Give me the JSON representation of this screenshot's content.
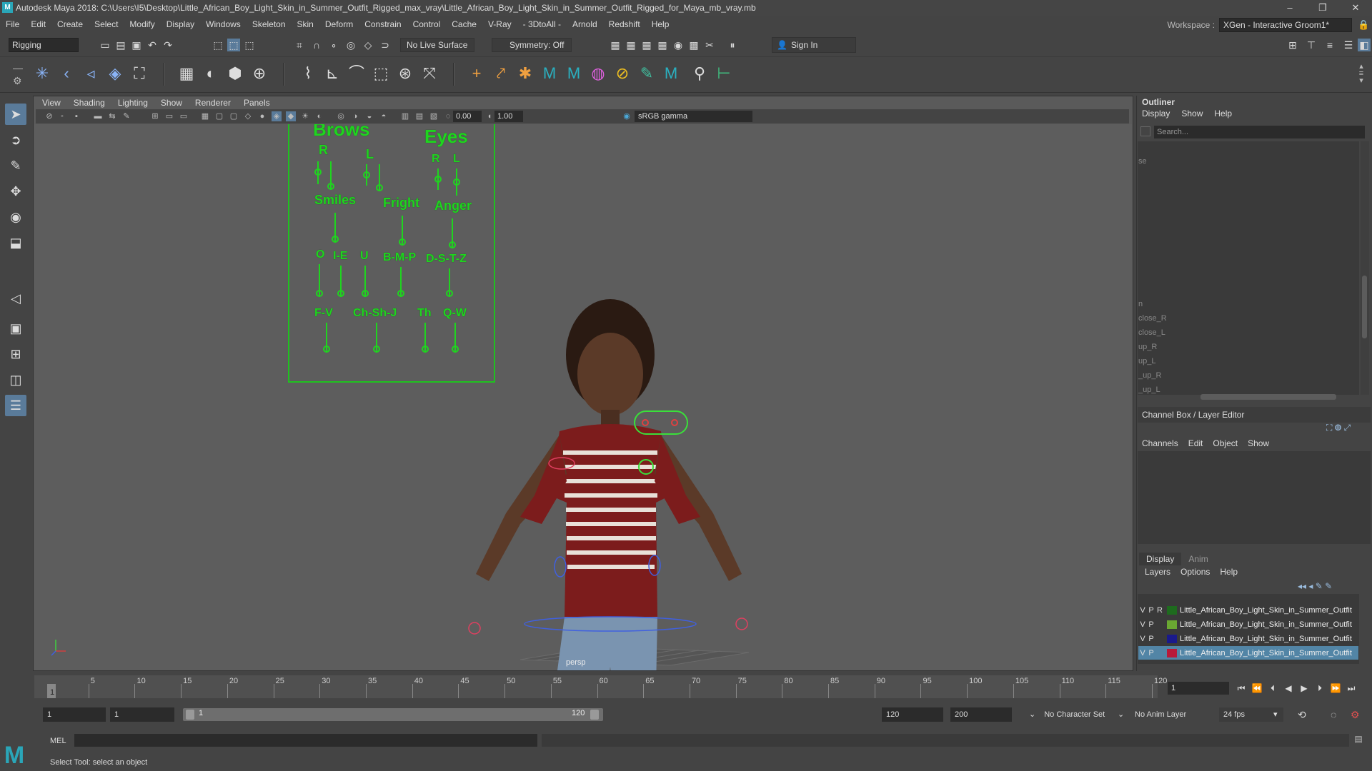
{
  "window": {
    "title": "Autodesk Maya 2018: C:\\Users\\I5\\Desktop\\Little_African_Boy_Light_Skin_in_Summer_Outfit_Rigged_max_vray\\Little_African_Boy_Light_Skin_in_Summer_Outfit_Rigged_for_Maya_mb_vray.mb",
    "app_icon": "M",
    "minimize": "–",
    "maximize": "❐",
    "close": "✕"
  },
  "menubar": {
    "items": [
      "File",
      "Edit",
      "Create",
      "Select",
      "Modify",
      "Display",
      "Windows",
      "Skeleton",
      "Skin",
      "Deform",
      "Constrain",
      "Control",
      "Cache",
      "V-Ray",
      "- 3DtoAll -",
      "Arnold",
      "Redshift",
      "Help"
    ],
    "workspace_label": "Workspace :",
    "workspace_value": "XGen - Interactive Groom1*"
  },
  "statusline": {
    "mode": "Rigging",
    "live_surface": "No Live Surface",
    "symmetry": "Symmetry: Off",
    "sign_in": "Sign In"
  },
  "viewport": {
    "menu": [
      "View",
      "Shading",
      "Lighting",
      "Show",
      "Renderer",
      "Panels"
    ],
    "exposure": "0.00",
    "gamma_value": "1.00",
    "color_space": "sRGB gamma",
    "camera_label": "persp"
  },
  "faceboard": {
    "brows": "Brows",
    "eyes": "Eyes",
    "r1": "R",
    "l1": "L",
    "r2": "R",
    "l2": "L",
    "smiles": "Smiles",
    "fright": "Fright",
    "anger": "Anger",
    "o": "O",
    "ie": "I-E",
    "u": "U",
    "bmp": "B-M-P",
    "dstz": "D-S-T-Z",
    "fv": "F-V",
    "chshj": "Ch-Sh-J",
    "th": "Th",
    "qw": "Q-W"
  },
  "outliner": {
    "title": "Outliner",
    "menu": [
      "Display",
      "Show",
      "Help"
    ],
    "search_placeholder": "Search...",
    "items": [
      "se",
      "n",
      "close_R",
      "close_L",
      "up_R",
      "up_L",
      "_up_R",
      "_up_L"
    ]
  },
  "channelbox": {
    "title": "Channel Box / Layer Editor",
    "menu": [
      "Channels",
      "Edit",
      "Object",
      "Show"
    ]
  },
  "layers": {
    "tabs": [
      "Display",
      "Anim"
    ],
    "menu": [
      "Layers",
      "Options",
      "Help"
    ],
    "rows": [
      {
        "v": "V",
        "p": "P",
        "r": "R",
        "color": "#1e6b1e",
        "name": "Little_African_Boy_Light_Skin_in_Summer_Outfit"
      },
      {
        "v": "V",
        "p": "P",
        "r": "",
        "color": "#6aa832",
        "name": "Little_African_Boy_Light_Skin_in_Summer_Outfit"
      },
      {
        "v": "V",
        "p": "P",
        "r": "",
        "color": "#1a1a8c",
        "name": "Little_African_Boy_Light_Skin_in_Summer_Outfit"
      },
      {
        "v": "V",
        "p": "P",
        "r": "",
        "color": "#b81a3a",
        "name": "Little_African_Boy_Light_Skin_in_Summer_Outfit"
      }
    ]
  },
  "timeline": {
    "ticks": [
      "5",
      "10",
      "15",
      "20",
      "25",
      "30",
      "35",
      "40",
      "45",
      "50",
      "55",
      "60",
      "65",
      "70",
      "75",
      "80",
      "85",
      "90",
      "95",
      "100",
      "105",
      "110",
      "115",
      "120"
    ],
    "start_marker": "1",
    "current_frame": "1"
  },
  "range": {
    "start": "1",
    "playback_start": "1",
    "slider_start": "1",
    "slider_end": "120",
    "playback_end": "120",
    "end": "200",
    "character_set": "No Character Set",
    "anim_layer": "No Anim Layer",
    "fps": "24 fps"
  },
  "cmdline": {
    "label": "MEL",
    "help": "Select Tool: select an object"
  },
  "colors": {
    "accent": "#5a7b9a",
    "faceboard_green": "#1fd41f"
  }
}
